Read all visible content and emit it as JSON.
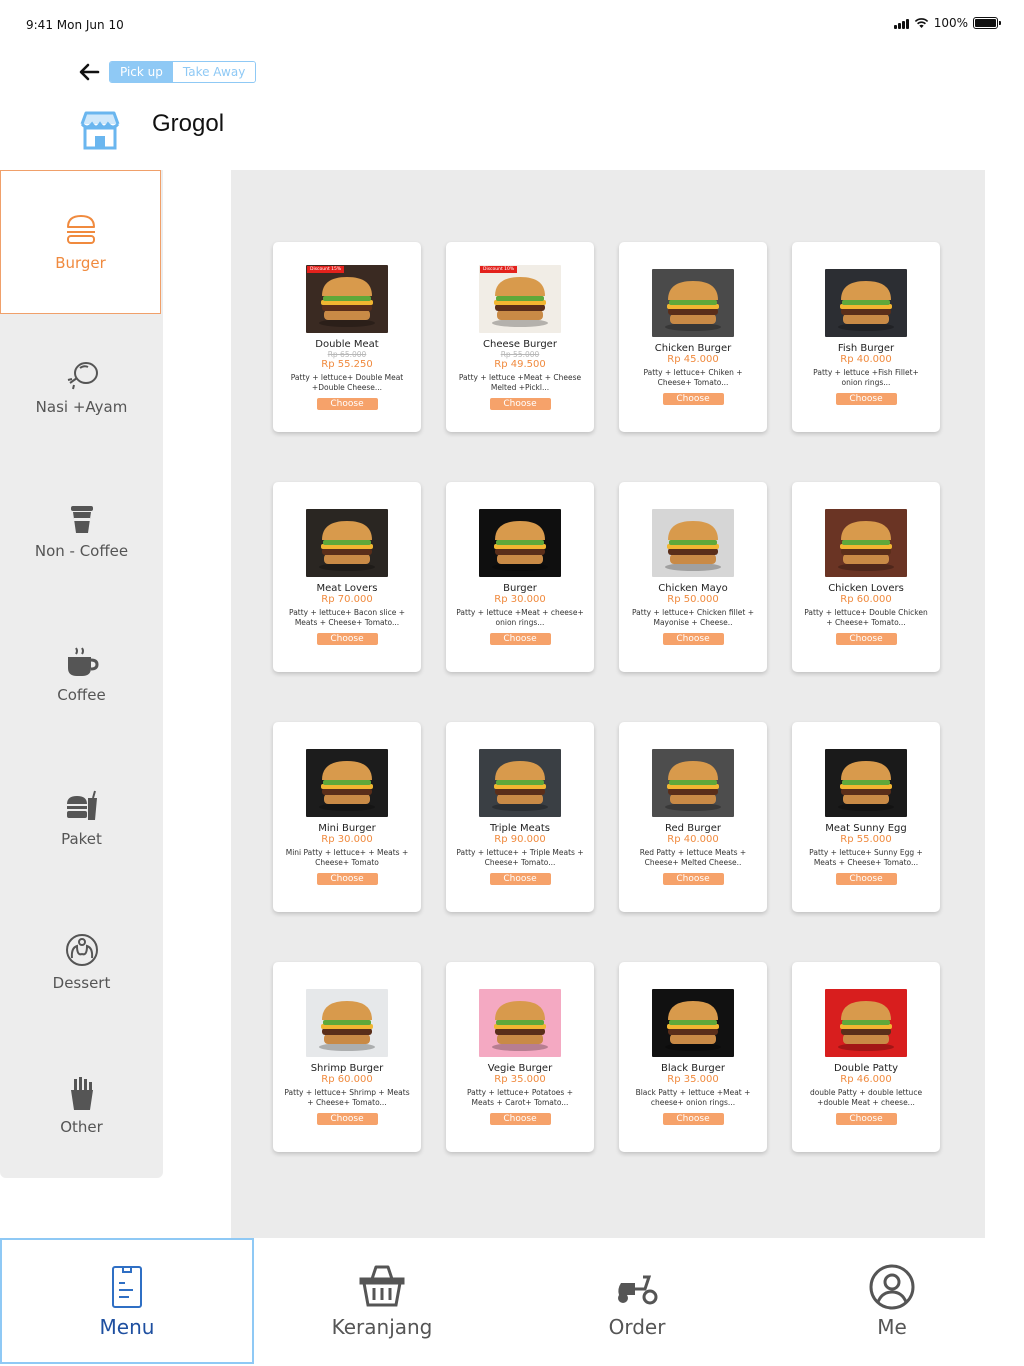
{
  "status_bar": {
    "time": "9:41  Mon Jun 10",
    "battery": "100%"
  },
  "header": {
    "back_icon": "arrow-left-icon",
    "toggle": {
      "options": [
        "Pick up",
        "Take Away"
      ],
      "selected": "Pick up"
    },
    "store_icon": "store-icon",
    "store_name": "Grogol"
  },
  "colors": {
    "accent": "#f08a3e",
    "toggle_blue": "#8fc9f5",
    "nav_active": "#1e4fa0",
    "discount": "#e3211c",
    "panel": "#ebebeb"
  },
  "sidebar": {
    "selected": "Burger",
    "items": [
      {
        "label": "Burger",
        "icon": "burger-icon"
      },
      {
        "label": "Nasi +Ayam",
        "icon": "chicken-leg-icon"
      },
      {
        "label": "Non - Coffee",
        "icon": "cup-icon"
      },
      {
        "label": "Coffee",
        "icon": "coffee-cup-icon"
      },
      {
        "label": "Paket",
        "icon": "meal-combo-icon"
      },
      {
        "label": "Dessert",
        "icon": "dessert-icon"
      },
      {
        "label": "Other",
        "icon": "fries-icon"
      }
    ]
  },
  "menu": {
    "choose_label": "Choose",
    "items": [
      {
        "name": "Double Meat",
        "discount": "Discount 15%",
        "old_price": "Rp 65.000",
        "price": "Rp 55.250",
        "desc": "Patty + lettuce+ Double Meat +Double Cheese..."
      },
      {
        "name": "Cheese Burger",
        "discount": "Discount 10%",
        "old_price": "Rp 55.000",
        "price": "Rp 49.500",
        "desc": "Patty + lettuce +Meat + Cheese Melted +Pickl..."
      },
      {
        "name": "Chicken Burger",
        "price": "Rp 45.000",
        "desc": "Patty + lettuce+ Chiken + Cheese+  Tomato..."
      },
      {
        "name": "Fish Burger",
        "price": "Rp 40.000",
        "desc": "Patty + lettuce +Fish Fillet+ onion rings..."
      },
      {
        "name": "Meat Lovers",
        "price": "Rp 70.000",
        "desc": "Patty + lettuce+ Bacon slice + Meats + Cheese+  Tomato..."
      },
      {
        "name": "Burger",
        "price": "Rp 30.000",
        "desc": "Patty + lettuce +Meat + cheese+ onion rings..."
      },
      {
        "name": "Chicken Mayo",
        "price": "Rp 50.000",
        "desc": "Patty + lettuce+ Chicken fillet + Mayonise + Cheese.."
      },
      {
        "name": "Chicken Lovers",
        "price": "Rp 60.000",
        "desc": "Patty + lettuce+ Double Chicken + Cheese+  Tomato..."
      },
      {
        "name": "Mini Burger",
        "price": "Rp 30.000",
        "desc": "Mini Patty + lettuce+ + Meats + Cheese+  Tomato"
      },
      {
        "name": "Triple Meats",
        "price": "Rp 90.000",
        "desc": "Patty + lettuce+ + Triple Meats + Cheese+  Tomato..."
      },
      {
        "name": "Red Burger",
        "price": "Rp 40.000",
        "desc": "Red Patty + lettuce Meats + Cheese+ Melted Cheese.."
      },
      {
        "name": "Meat Sunny Egg",
        "price": "Rp 55.000",
        "desc": "Patty + lettuce+ Sunny Egg + Meats + Cheese+  Tomato..."
      },
      {
        "name": "Shrimp Burger",
        "price": "Rp 60.000",
        "desc": "Patty + lettuce+ Shrimp + Meats + Cheese+  Tomato..."
      },
      {
        "name": "Vegie Burger",
        "price": "Rp 35.000",
        "desc": "Patty + lettuce+ Potatoes + Meats + Carot+  Tomato..."
      },
      {
        "name": "Black Burger",
        "price": "Rp 35.000",
        "desc": "Black Patty + lettuce +Meat + cheese+ onion rings..."
      },
      {
        "name": "Double Patty",
        "price": "Rp 46.000",
        "desc": "double Patty + double lettuce +double Meat + cheese..."
      }
    ]
  },
  "bottom_nav": {
    "selected": "Menu",
    "items": [
      {
        "label": "Menu",
        "icon": "menu-list-icon"
      },
      {
        "label": "Keranjang",
        "icon": "basket-icon"
      },
      {
        "label": "Order",
        "icon": "scooter-icon"
      },
      {
        "label": "Me",
        "icon": "user-icon"
      }
    ]
  }
}
